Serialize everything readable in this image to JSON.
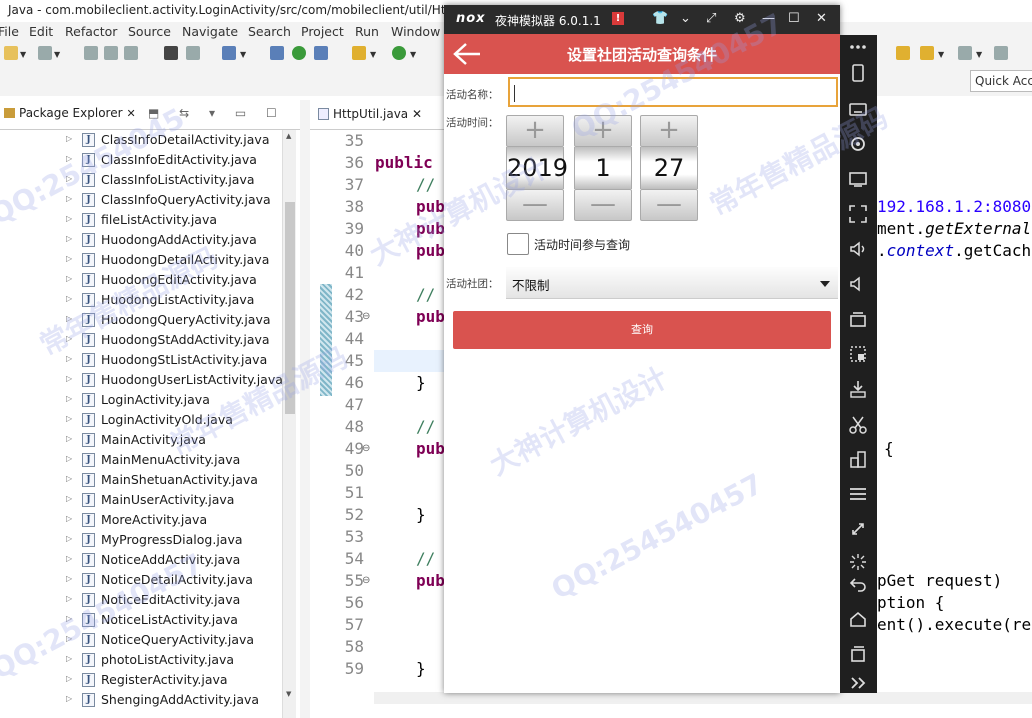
{
  "eclipse": {
    "window_title": "Java - com.mobileclient.activity.LoginActivity/src/com/mobileclient/util/Htt",
    "menu": [
      "File",
      "Edit",
      "Refactor",
      "Source",
      "Navigate",
      "Search",
      "Project",
      "Run",
      "Window"
    ],
    "quick_access": "Quick Acc",
    "package_explorer": {
      "tab_label": "Package Explorer",
      "close_glyph": "✕",
      "toolbar_glyphs": "⬒ ⇆ ▾ ▭ ☐",
      "files": [
        "ClassInfoDetailActivity.java",
        "ClassInfoEditActivity.java",
        "ClassInfoListActivity.java",
        "ClassInfoQueryActivity.java",
        "fileListActivity.java",
        "HuodongAddActivity.java",
        "HuodongDetailActivity.java",
        "HuodongEditActivity.java",
        "HuodongListActivity.java",
        "HuodongQueryActivity.java",
        "HuodongStAddActivity.java",
        "HuodongStListActivity.java",
        "HuodongUserListActivity.java",
        "LoginActivity.java",
        "LoginActivityOld.java",
        "MainActivity.java",
        "MainMenuActivity.java",
        "MainShetuanActivity.java",
        "MainUserActivity.java",
        "MoreActivity.java",
        "MyProgressDialog.java",
        "NoticeAddActivity.java",
        "NoticeDetailActivity.java",
        "NoticeEditActivity.java",
        "NoticeListActivity.java",
        "NoticeQueryActivity.java",
        "photoListActivity.java",
        "RegisterActivity.java",
        "ShengingAddActivity.java"
      ]
    },
    "editor": {
      "tab_label": "HttpUtil.java",
      "close_glyph": "✕",
      "line_numbers": [
        "35",
        "36",
        "37",
        "38",
        "39",
        "40",
        "41",
        "42",
        "43",
        "44",
        "45",
        "46",
        "47",
        "48",
        "49",
        "50",
        "51",
        "52",
        "53",
        "54",
        "55",
        "56",
        "57",
        "58",
        "59"
      ],
      "folded_lines": [
        "43",
        "49",
        "55"
      ],
      "code_left": {
        "l36": "public",
        "comment": "//",
        "pub": "pub",
        "brace": "}"
      },
      "code_right": {
        "l38": "192.168.1.2:8080",
        "l39a": "ment.",
        "l39b": "getExternal",
        "l40a": ".",
        "l40b": "context",
        "l40c": ".getCach",
        "l49": "{",
        "l55": "pGet request)",
        "l56": "ption {",
        "l57": "ent().execute(re"
      }
    }
  },
  "emulator": {
    "logo": "nox",
    "title": "夜神模拟器 6.0.1.1",
    "badge": "!",
    "controls": [
      "👕",
      "⌄",
      "⤢",
      "⚙",
      "—",
      "☐",
      "✕"
    ],
    "app": {
      "header_title": "设置社团活动查询条件",
      "activity_name_label": "活动名称：",
      "activity_name_value": "",
      "activity_time_label": "活动时间：",
      "date_picker": {
        "year": "2019",
        "month": "1",
        "day": "27",
        "plus": "+",
        "minus": "—"
      },
      "time_checkbox_label": "活动时间参与查询",
      "time_checkbox_checked": false,
      "club_label": "活动社团：",
      "club_value": "不限制",
      "query_button": "查询"
    },
    "side_toolbar_icons": [
      "more-icon",
      "phone-rotate-icon",
      "keyboard-icon",
      "location-icon",
      "screen-icon",
      "fullscreen-icon",
      "volume-up-icon",
      "volume-down-icon",
      "multi-instance-icon",
      "screenshot-icon",
      "apk-install-icon",
      "cut-icon",
      "dock-icon",
      "menu-icon",
      "shake-icon",
      "loading-icon",
      "back-icon",
      "home-icon",
      "recents-icon",
      "expand-icon"
    ]
  },
  "watermarks": [
    "QQ:25454045",
    "常年售精品源码",
    "大神计算机设计",
    "QQ:254540457",
    "常年售精品源码",
    "大神计算机设计",
    "QQ:254540457",
    "QQ:254540457",
    "常年售精品源码"
  ]
}
